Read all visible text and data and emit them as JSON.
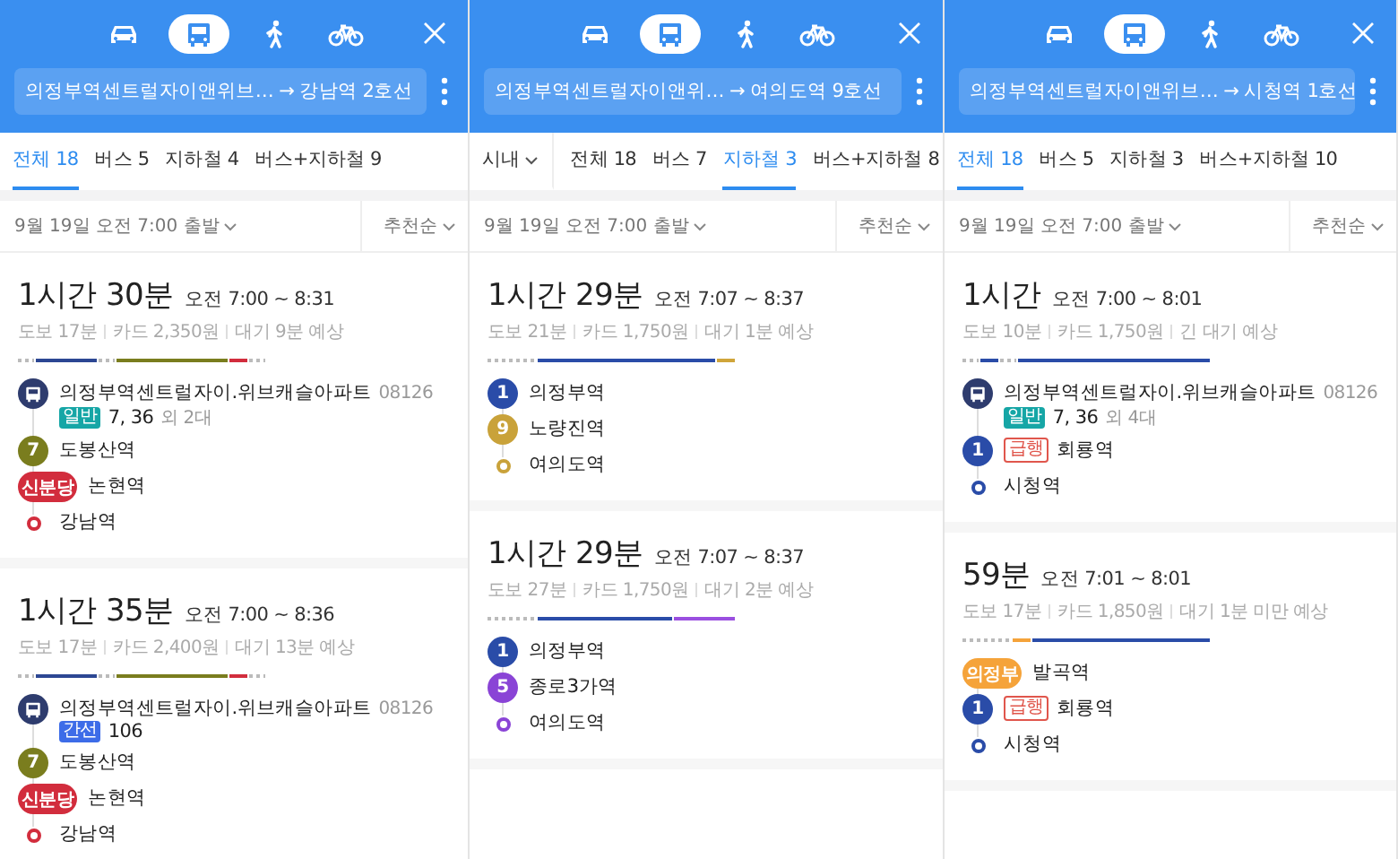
{
  "panels": [
    {
      "modes": [
        {
          "kind": "car",
          "selected": false
        },
        {
          "kind": "bus",
          "selected": true
        },
        {
          "kind": "walk",
          "selected": false
        },
        {
          "kind": "bike",
          "selected": false
        }
      ],
      "route_field": "의정부역센트럴자이앤위브… → 강남역 2호선",
      "tabs": [
        {
          "label": "전체 18",
          "selected": true
        },
        {
          "label": "버스 5",
          "selected": false
        },
        {
          "label": "지하철 4",
          "selected": false
        },
        {
          "label": "버스+지하철 9",
          "selected": false
        }
      ],
      "departure": "9월 19일 오전 7:00 출발",
      "sort": "추천순",
      "routes": [
        {
          "duration": "1시간 30분",
          "time": "오전 7:00 ~ 8:31",
          "summary": [
            "도보 17분",
            "카드 2,350원",
            "대기 9분 예상"
          ],
          "segments": [
            {
              "kind": "walk"
            },
            {
              "kind": "ride",
              "color": "#2c4793"
            },
            {
              "kind": "walk"
            },
            {
              "kind": "long-ride",
              "color": "#7a7d1e"
            },
            {
              "kind": "short-ride",
              "color": "#d22d3d"
            },
            {
              "kind": "walk"
            }
          ],
          "steps": [
            {
              "kind": "bus",
              "color": "#2e3c6e",
              "name": "의정부역센트럴자이.위브캐슬아파트",
              "code": "08126",
              "tag": {
                "kind": "general",
                "text": "일반"
              },
              "numbers": "7, 36",
              "extra": "외 2대"
            },
            {
              "kind": "station",
              "color": "#7a7d1e",
              "badge": "7",
              "name": "도봉산역"
            },
            {
              "kind": "station",
              "color": "#d22d3d",
              "badge": "신분당",
              "name": "논현역"
            },
            {
              "kind": "end",
              "color": "#d22d3d",
              "name": "강남역"
            }
          ]
        },
        {
          "duration": "1시간 35분",
          "time": "오전 7:00 ~ 8:36",
          "summary": [
            "도보 17분",
            "카드 2,400원",
            "대기 13분 예상"
          ],
          "segments": [
            {
              "kind": "walk"
            },
            {
              "kind": "ride",
              "color": "#2c4793"
            },
            {
              "kind": "walk"
            },
            {
              "kind": "long-ride",
              "color": "#7a7d1e"
            },
            {
              "kind": "short-ride",
              "color": "#d22d3d"
            },
            {
              "kind": "walk"
            }
          ],
          "steps": [
            {
              "kind": "bus",
              "color": "#2e3c6e",
              "name": "의정부역센트럴자이.위브캐슬아파트",
              "code": "08126",
              "tag": {
                "kind": "trunk",
                "text": "간선"
              },
              "numbers": "106"
            },
            {
              "kind": "station",
              "color": "#7a7d1e",
              "badge": "7",
              "name": "도봉산역"
            },
            {
              "kind": "station",
              "color": "#d22d3d",
              "badge": "신분당",
              "name": "논현역"
            },
            {
              "kind": "end",
              "color": "#d22d3d",
              "name": "강남역"
            }
          ]
        }
      ]
    },
    {
      "modes": [
        {
          "kind": "car",
          "selected": false
        },
        {
          "kind": "bus",
          "selected": true
        },
        {
          "kind": "walk",
          "selected": false
        },
        {
          "kind": "bike",
          "selected": false
        }
      ],
      "route_field": "의정부역센트럴자이앤위… → 여의도역 9호선",
      "scope": "시내",
      "tabs": [
        {
          "label": "전체 18",
          "selected": false
        },
        {
          "label": "버스 7",
          "selected": false
        },
        {
          "label": "지하철 3",
          "selected": true
        },
        {
          "label": "버스+지하철 8",
          "selected": false
        }
      ],
      "departure": "9월 19일 오전 7:00 출발",
      "sort": "추천순",
      "routes": [
        {
          "duration": "1시간 29분",
          "time": "오전 7:07 ~ 8:37",
          "summary": [
            "도보 21분",
            "카드 1,750원",
            "대기 1분 예상"
          ],
          "segments": [
            {
              "kind": "long-walk"
            },
            {
              "kind": "long-ride",
              "color": "#2a4ca8"
            },
            {
              "kind": "short-ride",
              "color": "#d0a53a"
            }
          ],
          "steps": [
            {
              "kind": "station",
              "color": "#2a4ca8",
              "badge": "1",
              "name": "의정부역"
            },
            {
              "kind": "station",
              "color": "#c9a23a",
              "badge": "9",
              "name": "노량진역"
            },
            {
              "kind": "end",
              "color": "#c9a23a",
              "name": "여의도역"
            }
          ]
        },
        {
          "duration": "1시간 29분",
          "time": "오전 7:07 ~ 8:37",
          "summary": [
            "도보 27분",
            "카드 1,750원",
            "대기 2분 예상"
          ],
          "segments": [
            {
              "kind": "long-walk"
            },
            {
              "kind": "long-ride",
              "color": "#2a4ca8"
            },
            {
              "kind": "ride",
              "color": "#9a4fe0"
            }
          ],
          "steps": [
            {
              "kind": "station",
              "color": "#2a4ca8",
              "badge": "1",
              "name": "의정부역"
            },
            {
              "kind": "station",
              "color": "#8a44d6",
              "badge": "5",
              "name": "종로3가역"
            },
            {
              "kind": "end",
              "color": "#8a44d6",
              "name": "여의도역"
            }
          ]
        }
      ]
    },
    {
      "modes": [
        {
          "kind": "car",
          "selected": false
        },
        {
          "kind": "bus",
          "selected": true
        },
        {
          "kind": "walk",
          "selected": false
        },
        {
          "kind": "bike",
          "selected": false
        }
      ],
      "route_field": "의정부역센트럴자이앤위브… → 시청역 1호선",
      "tabs": [
        {
          "label": "전체 18",
          "selected": true
        },
        {
          "label": "버스 5",
          "selected": false
        },
        {
          "label": "지하철 3",
          "selected": false
        },
        {
          "label": "버스+지하철 10",
          "selected": false
        }
      ],
      "departure": "9월 19일 오전 7:00 출발",
      "sort": "추천순",
      "routes": [
        {
          "duration": "1시간",
          "time": "오전 7:00 ~ 8:01",
          "summary": [
            "도보 10분",
            "카드 1,750원",
            "긴 대기 예상"
          ],
          "segments": [
            {
              "kind": "walk"
            },
            {
              "kind": "short-ride",
              "color": "#2a4ca8"
            },
            {
              "kind": "walk"
            },
            {
              "kind": "long-ride",
              "color": "#2a4ca8"
            }
          ],
          "steps": [
            {
              "kind": "bus",
              "color": "#2e3c6e",
              "name": "의정부역센트럴자이.위브캐슬아파트",
              "code": "08126",
              "tag": {
                "kind": "general",
                "text": "일반"
              },
              "numbers": "7, 36",
              "extra": "외 4대"
            },
            {
              "kind": "station",
              "color": "#2a4ca8",
              "badge": "1",
              "tag": {
                "kind": "express",
                "text": "급행"
              },
              "name": "회룡역"
            },
            {
              "kind": "end",
              "color": "#2a4ca8",
              "name": "시청역"
            }
          ]
        },
        {
          "duration": "59분",
          "time": "오전 7:01 ~ 8:01",
          "summary": [
            "도보 17분",
            "카드 1,850원",
            "대기 1분 미만 예상"
          ],
          "segments": [
            {
              "kind": "long-walk"
            },
            {
              "kind": "short-ride",
              "color": "#f5a33a"
            },
            {
              "kind": "long-ride",
              "color": "#2a4ca8"
            }
          ],
          "steps": [
            {
              "kind": "station",
              "color": "#f5a33a",
              "badge": "의정부",
              "name": "발곡역"
            },
            {
              "kind": "station",
              "color": "#2a4ca8",
              "badge": "1",
              "tag": {
                "kind": "express",
                "text": "급행"
              },
              "name": "회룡역"
            },
            {
              "kind": "end",
              "color": "#2a4ca8",
              "name": "시청역"
            }
          ]
        }
      ]
    }
  ]
}
